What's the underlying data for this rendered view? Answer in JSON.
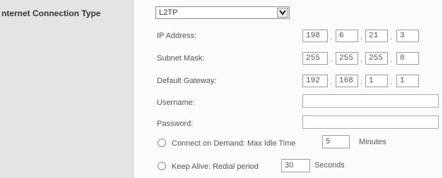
{
  "section": {
    "title": "nternet Connection Type"
  },
  "connection_type": {
    "selected": "L2TP"
  },
  "ip_address": {
    "label": "IP Address:",
    "octets": [
      "198",
      "6",
      "21",
      "3"
    ]
  },
  "subnet_mask": {
    "label": "Subnet Mask:",
    "octets": [
      "255",
      "255",
      "255",
      "0"
    ]
  },
  "default_gateway": {
    "label": "Default Gateway:",
    "octets": [
      "192",
      "168",
      "1",
      "1"
    ]
  },
  "username": {
    "label": "Username:",
    "value": ""
  },
  "password": {
    "label": "Password:",
    "value": ""
  },
  "connect_on_demand": {
    "label": "Connect on Demand: Max Idle Time",
    "value": "5",
    "unit": "Minutes"
  },
  "keep_alive": {
    "label": "Keep Alive: Redial period",
    "value": "30",
    "unit": "Seconds"
  },
  "octet_separator": "."
}
